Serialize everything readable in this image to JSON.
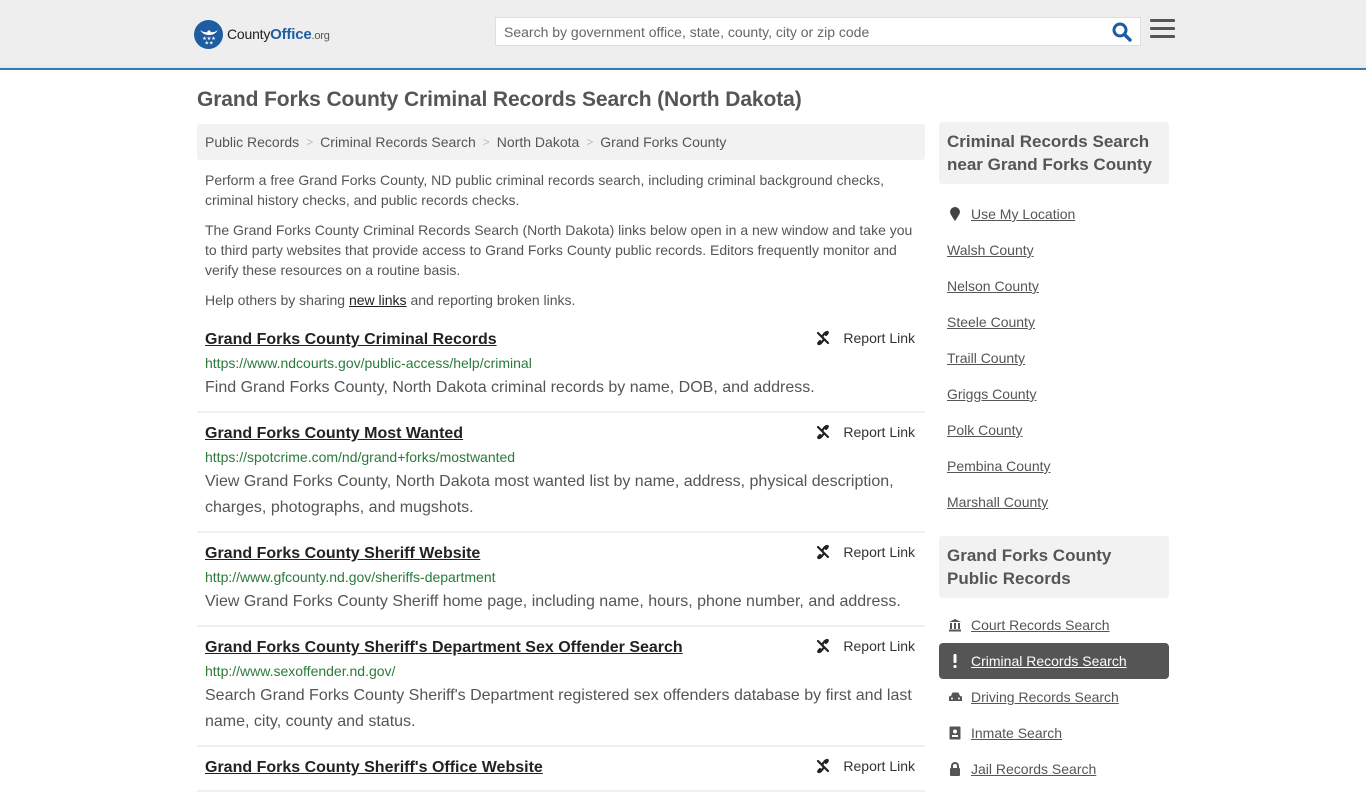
{
  "header": {
    "logo": {
      "county": "County",
      "office": "Office",
      "tld": ".org"
    },
    "search_placeholder": "Search by government office, state, county, city or zip code",
    "search_value": ""
  },
  "page_title": "Grand Forks County Criminal Records Search (North Dakota)",
  "breadcrumb": [
    "Public Records",
    "Criminal Records Search",
    "North Dakota",
    "Grand Forks County"
  ],
  "intro": {
    "p1": "Perform a free Grand Forks County, ND public criminal records search, including criminal background checks, criminal history checks, and public records checks.",
    "p2": "The Grand Forks County Criminal Records Search (North Dakota) links below open in a new window and take you to third party websites that provide access to Grand Forks County public records. Editors frequently monitor and verify these resources on a routine basis.",
    "p3_before": "Help others by sharing ",
    "p3_link": "new links",
    "p3_after": " and reporting broken links."
  },
  "report_label": "Report Link",
  "results": [
    {
      "title": "Grand Forks County Criminal Records",
      "url": "https://www.ndcourts.gov/public-access/help/criminal",
      "desc": "Find Grand Forks County, North Dakota criminal records by name, DOB, and address."
    },
    {
      "title": "Grand Forks County Most Wanted",
      "url": "https://spotcrime.com/nd/grand+forks/mostwanted",
      "desc": "View Grand Forks County, North Dakota most wanted list by name, address, physical description, charges, photographs, and mugshots."
    },
    {
      "title": "Grand Forks County Sheriff Website",
      "url": "http://www.gfcounty.nd.gov/sheriffs-department",
      "desc": "View Grand Forks County Sheriff home page, including name, hours, phone number, and address."
    },
    {
      "title": "Grand Forks County Sheriff's Department Sex Offender Search",
      "url": "http://www.sexoffender.nd.gov/",
      "desc": "Search Grand Forks County Sheriff's Department registered sex offenders database by first and last name, city, county and status."
    },
    {
      "title": "Grand Forks County Sheriff's Office Website",
      "url": "",
      "desc": ""
    }
  ],
  "sidebar_nearby": {
    "heading": "Criminal Records Search near Grand Forks County",
    "use_location": "Use My Location",
    "counties": [
      "Walsh County",
      "Nelson County",
      "Steele County",
      "Traill County",
      "Griggs County",
      "Polk County",
      "Pembina County",
      "Marshall County"
    ]
  },
  "sidebar_public": {
    "heading": "Grand Forks County Public Records",
    "items": [
      {
        "label": "Court Records Search",
        "icon": "courthouse-icon",
        "active": false
      },
      {
        "label": "Criminal Records Search",
        "icon": "exclamation-icon",
        "active": true
      },
      {
        "label": "Driving Records Search",
        "icon": "car-icon",
        "active": false
      },
      {
        "label": "Inmate Search",
        "icon": "id-badge-icon",
        "active": false
      },
      {
        "label": "Jail Records Search",
        "icon": "lock-icon",
        "active": false
      }
    ]
  }
}
